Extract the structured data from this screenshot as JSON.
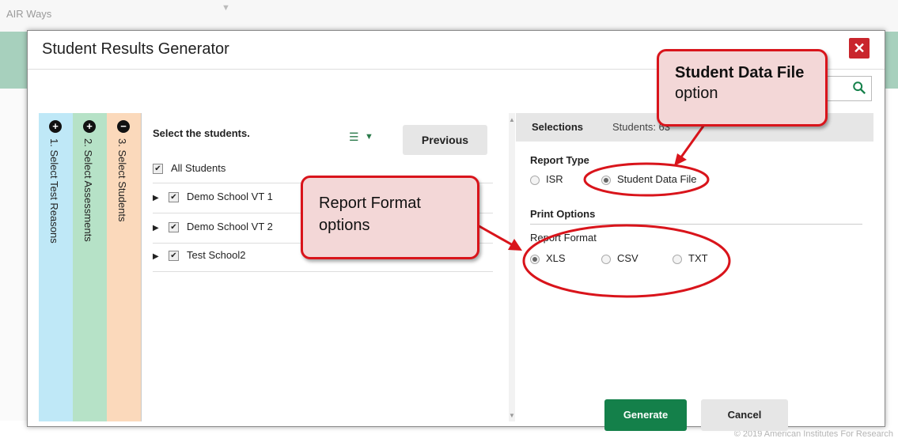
{
  "app": {
    "title": "AIR Ways"
  },
  "footer": {
    "copyright": "© 2019 American Institutes For Research"
  },
  "modal": {
    "title": "Student Results Generator",
    "close_icon": "close-icon"
  },
  "steps": [
    {
      "number": "1.",
      "label": "Select Test Reasons",
      "icon": "plus-circle-icon"
    },
    {
      "number": "2.",
      "label": "Select Assessments",
      "icon": "plus-circle-icon"
    },
    {
      "number": "3.",
      "label": "Select Students",
      "icon": "minus-circle-icon"
    }
  ],
  "students": {
    "heading": "Select the students.",
    "previous_label": "Previous",
    "all_label": "All Students",
    "schools": [
      "Demo School VT 1",
      "Demo School VT 2",
      "Test School2"
    ]
  },
  "selections": {
    "tab_label": "Selections",
    "students_label": "Students: 63",
    "report_type_label": "Report Type",
    "report_types": [
      "ISR",
      "Student Data File"
    ],
    "report_type_selected": "Student Data File",
    "print_options_label": "Print Options",
    "report_format_label": "Report Format",
    "formats": [
      "XLS",
      "CSV",
      "TXT"
    ],
    "format_selected": "XLS",
    "generate_label": "Generate",
    "cancel_label": "Cancel"
  },
  "callouts": {
    "student_data_file_bold": "Student Data File",
    "student_data_file_rest": "option",
    "report_format_line1": "Report Format",
    "report_format_line2": "options"
  },
  "colors": {
    "step1": "#bfe8f7",
    "step2": "#b6e2c7",
    "step3": "#fbd9bb",
    "generate": "#14804a",
    "close": "#c9252c",
    "callout_border": "#d9141b",
    "callout_fill": "#f3d7d7"
  }
}
